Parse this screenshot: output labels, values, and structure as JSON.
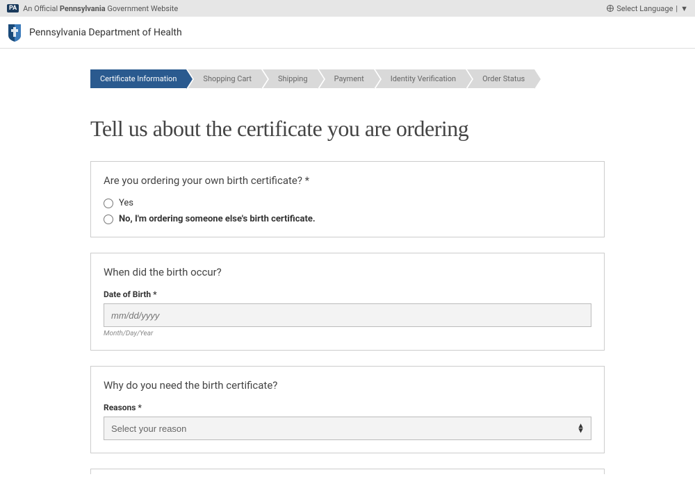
{
  "topbar": {
    "official_prefix": "An Official",
    "state": "Pennsylvania",
    "official_suffix": "Government Website",
    "language": "Select Language",
    "dropdown_symbol": "▼"
  },
  "header": {
    "department": "Pennsylvania Department of Health"
  },
  "breadcrumb": {
    "items": [
      {
        "label": "Certificate Information",
        "active": true
      },
      {
        "label": "Shopping Cart",
        "active": false
      },
      {
        "label": "Shipping",
        "active": false
      },
      {
        "label": "Payment",
        "active": false
      },
      {
        "label": "Identity Verification",
        "active": false
      },
      {
        "label": "Order Status",
        "active": false
      }
    ]
  },
  "page": {
    "title": "Tell us about the certificate you are ordering"
  },
  "section1": {
    "question": "Are you ordering your own birth certificate? *",
    "option_yes": "Yes",
    "option_no": "No, I'm ordering someone else's birth certificate."
  },
  "section2": {
    "question": "When did the birth occur?",
    "label": "Date of Birth *",
    "placeholder": "mm/dd/yyyy",
    "hint": "Month/Day/Year"
  },
  "section3": {
    "question": "Why do you need the birth certificate?",
    "label": "Reasons *",
    "placeholder": "Select your reason"
  }
}
